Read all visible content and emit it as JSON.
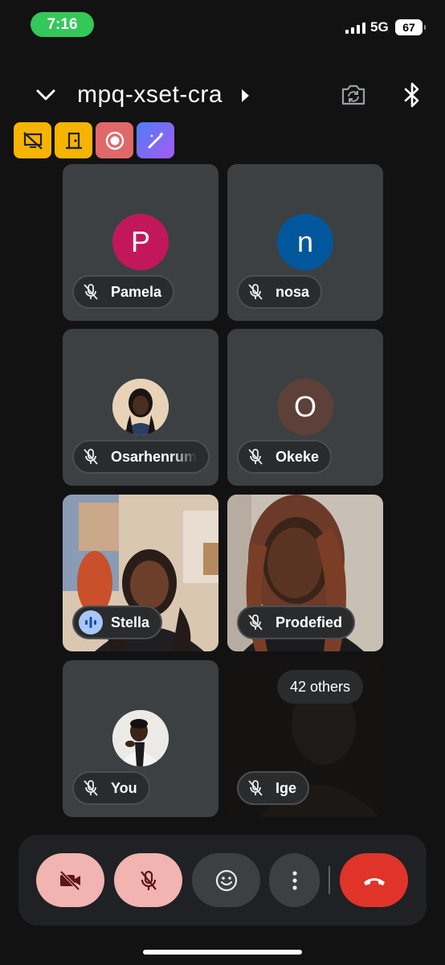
{
  "status": {
    "time": "7:16",
    "network": "5G",
    "battery": "67"
  },
  "header": {
    "meeting_code": "mpq-xset-cra"
  },
  "participants": [
    {
      "name": "Pamela",
      "initial": "P",
      "avatar_color": "#c2185b",
      "muted": true
    },
    {
      "name": "nosa",
      "initial": "n",
      "avatar_color": "#01579b",
      "muted": true
    },
    {
      "name": "Osarhenrum",
      "initial": "",
      "avatar_color": "#3c4043",
      "muted": true
    },
    {
      "name": "Okeke",
      "initial": "O",
      "avatar_color": "#5d4037",
      "muted": true
    },
    {
      "name": "Stella",
      "muted": false,
      "speaking": true
    },
    {
      "name": "Prodefied",
      "muted": true
    },
    {
      "name": "You",
      "muted": true
    },
    {
      "name": "Ige",
      "muted": true,
      "others_label": "42 others"
    }
  ],
  "controls": {
    "camera_icon": "camera-off-icon",
    "mic_icon": "mic-off-icon",
    "reactions_icon": "emoji-icon",
    "more_icon": "more-vert-icon",
    "end_call_icon": "end-call-icon"
  },
  "colors": {
    "accent_pink": "#f1b4b0",
    "end_call_red": "#e0342a",
    "tile_bg": "#3c4043",
    "time_green": "#34c759"
  }
}
